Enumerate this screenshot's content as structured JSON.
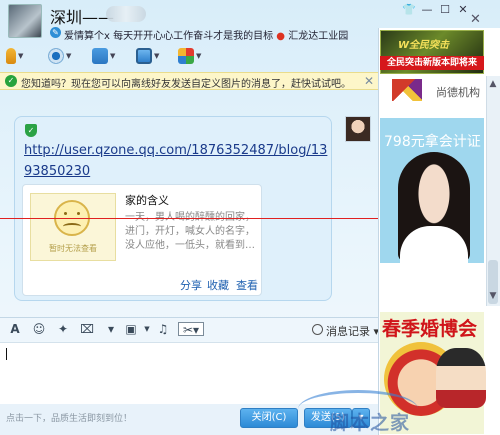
{
  "window": {
    "contact_name": "深圳——",
    "signature": "爱情算个x 每天开开心心工作奋斗才是我的目标",
    "location": "汇龙达工业园"
  },
  "icons": {
    "window": [
      "skin-icon",
      "minimize-icon",
      "maximize-icon",
      "close-icon"
    ],
    "toolbar": [
      "microphone-icon",
      "video-camera-icon",
      "file-transfer-icon",
      "remote-desktop-icon",
      "apps-icon"
    ],
    "compose": [
      "font-icon",
      "emoji-icon",
      "magic-icon",
      "screenshot-icon",
      "send-image-icon",
      "music-icon",
      "scissors-icon"
    ]
  },
  "notice": {
    "text": "您知道吗？现在您可以向离线好友发送自定义图片的消息了，赶快试试吧。"
  },
  "message": {
    "url_line1": "http://user.qzone.qq.com/1876352487/blog/13",
    "url_line2": "93850230",
    "card": {
      "thumb_text": "暂时无法查看",
      "title": "家的含义",
      "lines": [
        "一天，男人喝的醉醺的回家，",
        "进门，开灯，喊女人的名字，",
        "没人应他，一低头，就看到…"
      ],
      "share": "分享",
      "collect": "收藏",
      "view": "查看"
    }
  },
  "compose": {
    "history_label": "消息记录"
  },
  "footer": {
    "hint": "点击一下，品质生活即刻到位！",
    "close_label": "关闭(C)",
    "send_label": "发送(S)"
  },
  "ads": {
    "ad1_logo": "W全民突击",
    "ad1_text": "全民突击新版本即将来",
    "ad2_text": "尚德机构",
    "ad3_text": "798元拿会计证",
    "ad4_text": "春季婚博会"
  },
  "watermark": "脚本之家",
  "colors": {
    "accent": "#2d8ad6",
    "red_line": "#e02020",
    "link": "#1a3a8a"
  }
}
